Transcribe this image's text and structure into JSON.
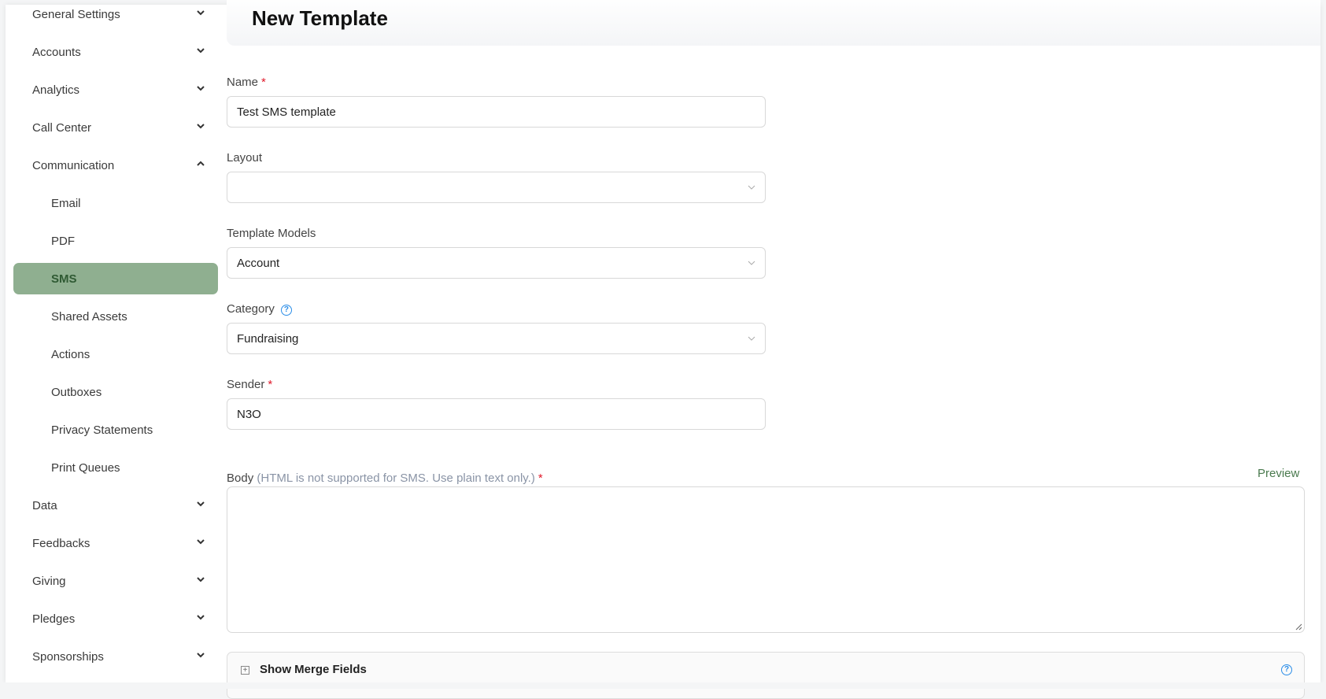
{
  "sidebar": {
    "items": [
      {
        "label": "General Settings",
        "type": "group",
        "state": "collapsed"
      },
      {
        "label": "Accounts",
        "type": "group",
        "state": "collapsed"
      },
      {
        "label": "Analytics",
        "type": "group",
        "state": "collapsed"
      },
      {
        "label": "Call Center",
        "type": "group",
        "state": "collapsed"
      },
      {
        "label": "Communication",
        "type": "group",
        "state": "expanded"
      },
      {
        "label": "Email",
        "type": "sub"
      },
      {
        "label": "PDF",
        "type": "sub"
      },
      {
        "label": "SMS",
        "type": "sub",
        "active": true
      },
      {
        "label": "Shared Assets",
        "type": "sub"
      },
      {
        "label": "Actions",
        "type": "sub"
      },
      {
        "label": "Outboxes",
        "type": "sub"
      },
      {
        "label": "Privacy Statements",
        "type": "sub"
      },
      {
        "label": "Print Queues",
        "type": "sub"
      },
      {
        "label": "Data",
        "type": "group",
        "state": "collapsed"
      },
      {
        "label": "Feedbacks",
        "type": "group",
        "state": "collapsed"
      },
      {
        "label": "Giving",
        "type": "group",
        "state": "collapsed"
      },
      {
        "label": "Pledges",
        "type": "group",
        "state": "collapsed"
      },
      {
        "label": "Sponsorships",
        "type": "group",
        "state": "collapsed"
      }
    ],
    "active_color": "#8faf90"
  },
  "header": {
    "title": "New Template"
  },
  "form": {
    "name": {
      "label": "Name",
      "required": "*",
      "value": "Test SMS template"
    },
    "layout": {
      "label": "Layout",
      "value": ""
    },
    "template_models": {
      "label": "Template Models",
      "value": "Account"
    },
    "category": {
      "label": "Category",
      "value": "Fundraising",
      "help": "?"
    },
    "sender": {
      "label": "Sender",
      "required": "*",
      "value": "N3O"
    },
    "body": {
      "label": "Body",
      "hint": "(HTML is not supported for SMS. Use plain text only.)",
      "required": "*",
      "value": "",
      "preview_label": "Preview"
    },
    "merge_fields": {
      "label": "Show Merge Fields",
      "help": "?"
    }
  }
}
